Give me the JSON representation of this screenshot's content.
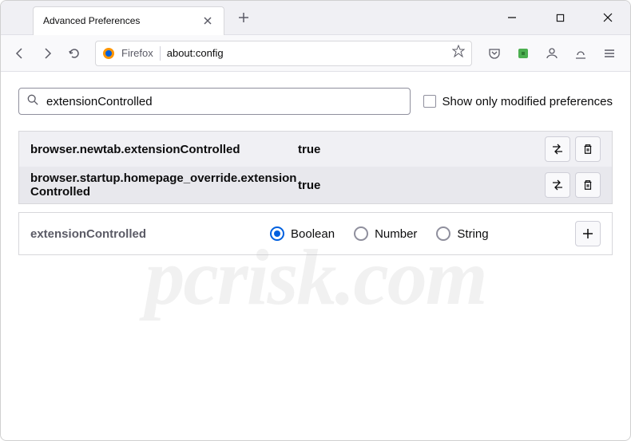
{
  "window": {
    "tab_title": "Advanced Preferences"
  },
  "navbar": {
    "identity_label": "Firefox",
    "url": "about:config"
  },
  "search": {
    "value": "extensionControlled",
    "checkbox_label": "Show only modified preferences"
  },
  "prefs": [
    {
      "name": "browser.newtab.extensionControlled",
      "value": "true"
    },
    {
      "name": "browser.startup.homepage_override.extensionControlled",
      "value": "true"
    }
  ],
  "new_pref": {
    "name": "extensionControlled",
    "types": [
      "Boolean",
      "Number",
      "String"
    ],
    "selected": "Boolean"
  },
  "watermark": "pcrisk.com"
}
